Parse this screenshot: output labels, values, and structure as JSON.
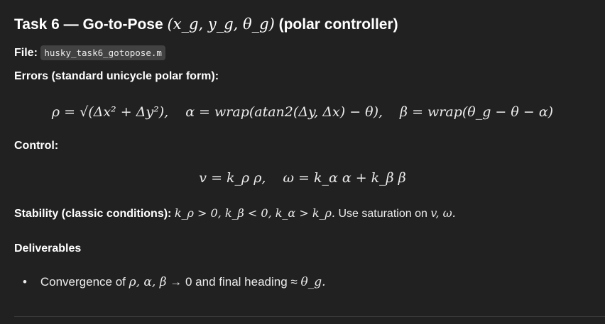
{
  "title": {
    "text": "Task 6 — Go-to-Pose",
    "math": "(x_g, y_g, θ_g)",
    "suffix": "(polar controller)"
  },
  "file": {
    "label": "File:",
    "filename": "husky_task6_gotopose.m"
  },
  "errors": {
    "heading": "Errors (standard unicycle polar form):",
    "rho": "ρ = √(Δx² + Δy²),",
    "alpha": "α = wrap(atan2(Δy, Δx) − θ),",
    "beta": "β = wrap(θ_g − θ − α)"
  },
  "control": {
    "heading": "Control:",
    "v": "v = k_ρ ρ,",
    "omega": "ω = k_α α + k_β β"
  },
  "stability": {
    "label": "Stability (classic conditions):",
    "conditions": "k_ρ > 0,  k_β < 0,  k_α > k_ρ.",
    "note": "Use saturation on",
    "vars": "v, ω."
  },
  "deliverables": {
    "heading": "Deliverables",
    "items": [
      {
        "text": "Convergence of",
        "math": "ρ, α, β",
        "rest": "→ 0 and final heading ≈",
        "goal": "θ_g."
      }
    ]
  }
}
